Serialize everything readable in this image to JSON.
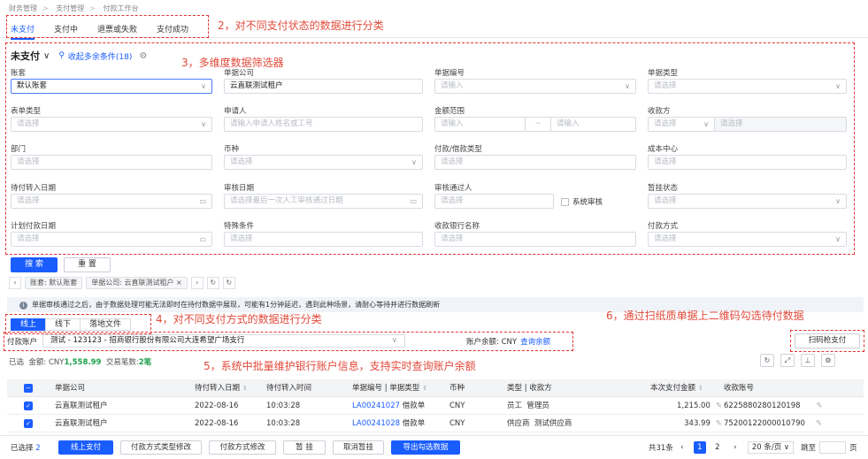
{
  "breadcrumb": [
    "财务管理",
    "支付管理",
    "付款工作台"
  ],
  "status_tabs": [
    "未支付",
    "支付中",
    "退票或失败",
    "支付成功"
  ],
  "callouts": {
    "c1": "2，对不同支付状态的数据进行分类",
    "c2": "3，多维度数据筛选器",
    "c3": "4，对不同支付方式的数据进行分类",
    "c4": "6，通过扫纸质单据上二维码勾选待付数据",
    "c5": "5，系统中批量维护银行账户信息，支持实时查询账户余额"
  },
  "filter": {
    "title": "未支付",
    "collapse_link": "收起多余条件(18)",
    "fields": [
      {
        "label": "账套",
        "value": "默认账套",
        "placeholder": ""
      },
      {
        "label": "单据公司",
        "value": "云直联测试租户",
        "placeholder": ""
      },
      {
        "label": "单据编号",
        "value": "",
        "placeholder": "请输入"
      },
      {
        "label": "单据类型",
        "value": "",
        "placeholder": "请选择"
      },
      {
        "label": "表单类型",
        "value": "",
        "placeholder": "请选择"
      },
      {
        "label": "申请人",
        "value": "",
        "placeholder": "请输入申请人姓名或工号"
      },
      {
        "label": "金额范围",
        "value": "",
        "placeholder": "请输入"
      },
      {
        "label": "收款方",
        "value": "",
        "placeholder": "请选择"
      },
      {
        "label": "部门",
        "value": "",
        "placeholder": "请选择"
      },
      {
        "label": "币种",
        "value": "",
        "placeholder": "请选择"
      },
      {
        "label": "付款/借款类型",
        "value": "",
        "placeholder": "请选择"
      },
      {
        "label": "成本中心",
        "value": "",
        "placeholder": "请选择"
      },
      {
        "label": "待付转入日期",
        "value": "",
        "placeholder": "请选择"
      },
      {
        "label": "审核日期",
        "value": "",
        "placeholder": "请选择最后一次人工审核通过日期"
      },
      {
        "label": "审核通过人",
        "value": "",
        "placeholder": "请选择"
      },
      {
        "label": "暂挂状态",
        "value": "",
        "placeholder": "请选择"
      },
      {
        "label": "计划付款日期",
        "value": "",
        "placeholder": "请选择"
      },
      {
        "label": "特殊条件",
        "value": "",
        "placeholder": "请选择"
      },
      {
        "label": "收款银行名称",
        "value": "",
        "placeholder": "请选择"
      },
      {
        "label": "付款方式",
        "value": "",
        "placeholder": "请选择"
      }
    ],
    "amount_to_placeholder": "请输入",
    "amount_sep": "~",
    "payee_second_placeholder": "请选择",
    "system_audit_label": "系统审核",
    "search_label": "搜 索",
    "reset_label": "重 置"
  },
  "chips": [
    "账套: 默认账套",
    "单据公司: 云直联测试租户"
  ],
  "notice": "单据审核通过之后，由于数据处理可能无法即时在待付数据中展现，可能有1分钟延迟，遇到此种场景，请耐心等待并进行数据刷新",
  "pay_tabs": [
    "线上",
    "线下",
    "落地文件"
  ],
  "account": {
    "label": "付款账户",
    "value": "测试 - 123123 - 招商银行股份有限公司大连希望广场支行",
    "balance_label": "账户余额: CNY",
    "balance_link": "查询余额",
    "scan_button": "扫码枪支付"
  },
  "summary": {
    "selected": "已选",
    "amount_label": "金额: CNY",
    "amount": "1,558.99",
    "count_label": "交易笔数:",
    "count": "2笔"
  },
  "table": {
    "headers": [
      "单据公司",
      "待付转入日期",
      "待付转入时间",
      "单据编号 | 单据类型",
      "币种",
      "类型 | 收款方",
      "本次支付金额",
      "收款账号"
    ],
    "rows": [
      {
        "company": "云直联测试租户",
        "date": "2022-08-16",
        "time": "10:03:28",
        "doc_no": "LA00241027",
        "doc_type": "借款单",
        "currency": "CNY",
        "type": "员工",
        "payee": "管理员",
        "amount": "1,215.00",
        "account": "6225880280120198"
      },
      {
        "company": "云直联测试租户",
        "date": "2022-08-16",
        "time": "10:03:28",
        "doc_no": "LA00241028",
        "doc_type": "借款单",
        "currency": "CNY",
        "type": "供应商",
        "payee": "测试供应商",
        "amount": "343.99",
        "account": "75200122000010790"
      }
    ]
  },
  "bottom": {
    "selected_label": "已选择",
    "selected_count": "2",
    "buttons": [
      "线上支付",
      "付款方式类型修改",
      "付款方式修改",
      "暂 挂",
      "取消暂挂",
      "导出勾选数据"
    ],
    "total": "共31条",
    "pages": [
      "1",
      "2"
    ],
    "page_size": "20 条/页",
    "jump_label": "跳至",
    "page_unit": "页"
  }
}
